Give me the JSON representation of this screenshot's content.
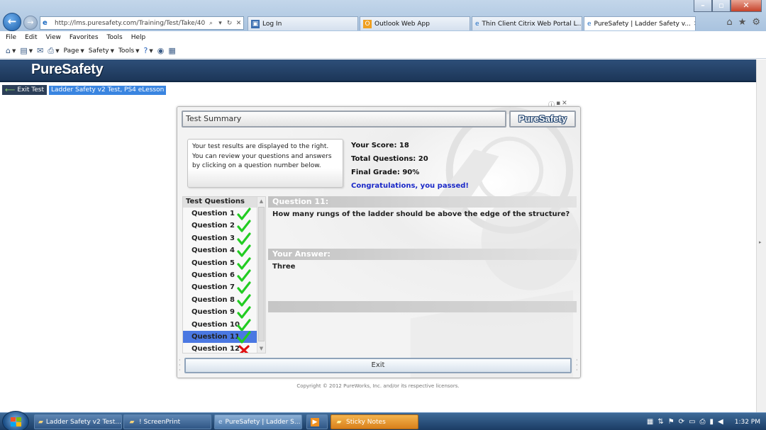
{
  "browser": {
    "address_url": "http://lms.puresafety.com/Training/Test/Take/40",
    "tabs": [
      {
        "label": "Log In",
        "active": false
      },
      {
        "label": "Outlook Web App",
        "active": false
      },
      {
        "label": "Thin Client Citrix Web Portal L...",
        "active": false
      },
      {
        "label": "PureSafety | Ladder Safety v...",
        "active": true
      }
    ],
    "menu": [
      "File",
      "Edit",
      "View",
      "Favorites",
      "Tools",
      "Help"
    ],
    "commands": [
      "Page",
      "Safety",
      "Tools"
    ]
  },
  "page": {
    "logo": "PureSafety",
    "exit_test_label": "Exit Test",
    "course_title": "Ladder Safety v2 Test, PS4 eLesson"
  },
  "dialog": {
    "title": "Test Summary",
    "badge": "PureSafety",
    "info_text": "Your test results are displayed to the right. You can review your questions and answers by clicking on a question number below.",
    "score_label": "Your Score: 18",
    "total_label": "Total Questions: 20",
    "grade_label": "Final Grade: 90%",
    "congrats": "Congratulations, you passed!",
    "questions_header": "Test Questions",
    "questions": [
      {
        "label": "Question 1",
        "correct": true
      },
      {
        "label": "Question 2",
        "correct": true
      },
      {
        "label": "Question 3",
        "correct": true
      },
      {
        "label": "Question 4",
        "correct": true
      },
      {
        "label": "Question 5",
        "correct": true
      },
      {
        "label": "Question 6",
        "correct": true
      },
      {
        "label": "Question 7",
        "correct": true
      },
      {
        "label": "Question 8",
        "correct": true
      },
      {
        "label": "Question 9",
        "correct": true
      },
      {
        "label": "Question 10",
        "correct": true
      },
      {
        "label": "Question 11",
        "correct": true,
        "selected": true
      },
      {
        "label": "Question 12",
        "correct": false
      }
    ],
    "question_band": "Question 11:",
    "question_text": "How many rungs of the ladder should be above the edge of the structure?",
    "answer_band": "Your Answer:",
    "answer_text": "Three",
    "exit_label": "Exit"
  },
  "copyright": "Copyright © 2012 PureWorks, Inc. and/or its respective licensors.",
  "taskbar": {
    "items": [
      {
        "label": "Ladder Safety v2 Test..."
      },
      {
        "label": "! ScreenPrint"
      },
      {
        "label": "PureSafety | Ladder S..."
      },
      {
        "label": ""
      },
      {
        "label": "Sticky Notes"
      }
    ],
    "clock": "1:32 PM"
  },
  "colors": {
    "header_navy": "#1c3658",
    "congrats_blue": "#1a28c8",
    "selected_row": "#4a78e2",
    "check_green": "#22cc22",
    "cross_red": "#e01010"
  }
}
